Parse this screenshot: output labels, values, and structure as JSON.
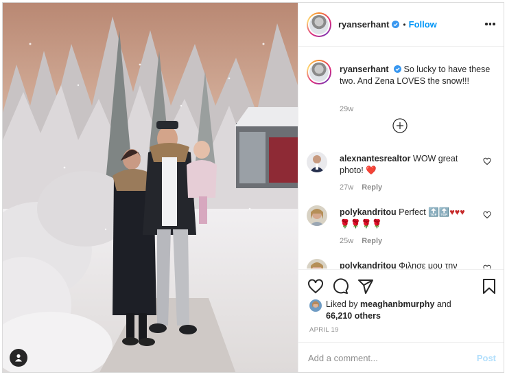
{
  "post": {
    "author": "ryanserhant",
    "follow_label": "Follow",
    "dot": "•",
    "verified": true
  },
  "caption": {
    "username": "ryanserhant",
    "text": "So lucky to have these two. And Zena LOVES the snow!!!",
    "age": "29w"
  },
  "comments": [
    {
      "username": "alexnantesrealtor",
      "text": "WOW great photo!",
      "emoji": "❤️",
      "age": "27w",
      "reply_label": "Reply"
    },
    {
      "username": "polykandritou",
      "text": "Perfect",
      "emoji": "🔝🔝♥♥♥ 🌹🌹🌹🌹",
      "age": "25w",
      "reply_label": "Reply"
    },
    {
      "username": "polykandritou",
      "text": "Φιλησε μου την"
    }
  ],
  "likes": {
    "prefix": "Liked by",
    "user": "meaghanbmurphy",
    "and": "and",
    "count_text": "66,210 others"
  },
  "date": "APRIL 19",
  "comment_box": {
    "placeholder": "Add a comment...",
    "post_label": "Post"
  },
  "colors": {
    "accent": "#0095f6",
    "post_disabled": "#b2dffc",
    "heart_red": "#ed4956",
    "muted_text": "#8e8e8e",
    "border": "#dbdbdb"
  },
  "icons": [
    "user-tag-icon",
    "verified-icon",
    "more-options-icon",
    "load-more-comments-icon",
    "like-icon",
    "comment-icon",
    "share-icon",
    "save-icon",
    "comment-like-icon"
  ]
}
